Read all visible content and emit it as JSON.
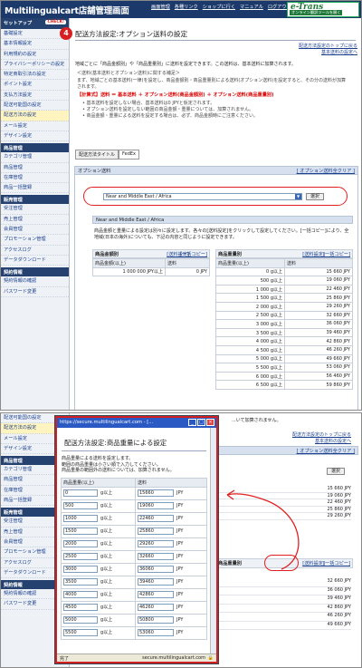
{
  "app_title": "Multilingualcart店舗管理画面",
  "topnav": [
    "画面管理",
    "各種リンク",
    "ショップに行く",
    "マニュアル",
    "ログアウト"
  ],
  "etrans": {
    "logo": "e-Trans",
    "tagline": "オンライン翻訳ツールを開く"
  },
  "setup_label": "セットアップ",
  "setup_btn": "CHECK!",
  "sidebar_setup": [
    "基礎設定",
    "基本情報設定",
    "利用規約の設定",
    "プライバシーポリシーの設定",
    "特定商取引法の設定",
    "ポイント設定",
    "支払方法設定",
    "配送可能国の設定",
    "配送方法の設定",
    "メール設定",
    "デザイン設定"
  ],
  "sidebar_sections": [
    {
      "title": "商品管理",
      "items": [
        "カテゴリ管理",
        "商品管理",
        "在庫管理",
        "商品一括登録"
      ]
    },
    {
      "title": "販売管理",
      "items": [
        "受注管理",
        "売上管理",
        "会員管理",
        "プロモーション管理",
        "アクセスログ",
        "データダウンロード"
      ]
    },
    {
      "title": "契約情報",
      "items": [
        "契約情報の確認",
        "パスワード変更"
      ]
    }
  ],
  "step_number": "4",
  "page_title": "配送方法設定:オプション送料の設定",
  "back_link_1": "配送方法設定のトップに戻る",
  "back_link_2": "基本送料の設定へ",
  "intro": "地域ごとに「商品金額別」や「商品重量別」に送料を設定できます。この送料は、基本送料に加算されます。",
  "notes_title": "＜送料(基本送料とオプション送料)に関する補足＞",
  "notes_text": "まず、地域ごとの基本送料(一律)を設定し、商品金額別・商品重量別による送料(オプション送料)を設定すると、その分の送料が加算されます。",
  "formula": "【計算式】送料 ＝ 基本送料 ＋ オプション送料(商品金額別) ＋ オプション送料(商品重量別)",
  "bullets": [
    "基本送料を設定しない場合、基本送料は0 JPYと仮定されます。",
    "オプション送料を設定しない範囲の商品金額・重量については、加算されません。",
    "商品金額・重量による送料を設定する場合は、必ず、商品金額時にご注意ください。"
  ],
  "tabs": [
    "配送方法タイトル",
    "FedEx"
  ],
  "option_box_title": "オプション送料",
  "option_box_link": "[ オプション送料全クリア ]",
  "region_selected": "Near and Middle East / Africa",
  "select_button": "選択",
  "region_heading": "Near and Middle East / Africa",
  "region_desc": "商品金額と重量による設定は別々に設定します。各々の[送料設定]をクリックして設定してください。[一括コピー]により、全地域(日本の海外)についても、下記の内容と同じように設定できます。",
  "price_table": {
    "title": "商品金額別",
    "links": [
      "[送料設定]",
      "[一括コピー]"
    ],
    "head": [
      "商品金額(以上)",
      "送料"
    ],
    "rows": [
      [
        "1 000 000 JPY以上",
        "0 JPY"
      ]
    ]
  },
  "weight_table": {
    "title": "商品重量別",
    "links": [
      "[送料設定]",
      "[一括コピー]"
    ],
    "head": [
      "商品重量(以上)",
      "送料"
    ],
    "rows": [
      [
        "0 g以上",
        "15 660 JPY"
      ],
      [
        "500 g以上",
        "19 060 JPY"
      ],
      [
        "1 000 g以上",
        "22 460 JPY"
      ],
      [
        "1 500 g以上",
        "25 860 JPY"
      ],
      [
        "2 000 g以上",
        "29 260 JPY"
      ],
      [
        "2 500 g以上",
        "32 660 JPY"
      ],
      [
        "3 000 g以上",
        "36 060 JPY"
      ],
      [
        "3 500 g以上",
        "39 460 JPY"
      ],
      [
        "4 000 g以上",
        "42 860 JPY"
      ],
      [
        "4 500 g以上",
        "46 260 JPY"
      ],
      [
        "5 000 g以上",
        "49 660 JPY"
      ],
      [
        "5 500 g以上",
        "53 060 JPY"
      ],
      [
        "6 000 g以上",
        "56 460 JPY"
      ],
      [
        "6 500 g以上",
        "59 860 JPY"
      ]
    ]
  },
  "popup": {
    "url": "https://secure.multilingualcart.com - [...",
    "title": "配送方法設定:商品重量による設定",
    "intro_lines": [
      "商品重量による送料を設定します。",
      "範囲の商品重量は小さい順で入力してください。",
      "商品重量の範囲外の送料については、加算されません。"
    ],
    "head": [
      "商品重量(以上)",
      "送料"
    ],
    "unit_g": "g以上",
    "unit_jpy": "JPY",
    "rows": [
      [
        "0",
        "15660"
      ],
      [
        "500",
        "19060"
      ],
      [
        "1000",
        "22460"
      ],
      [
        "1500",
        "25860"
      ],
      [
        "2000",
        "29260"
      ],
      [
        "2500",
        "32660"
      ],
      [
        "3000",
        "36060"
      ],
      [
        "3500",
        "39460"
      ],
      [
        "4000",
        "42860"
      ],
      [
        "4500",
        "46260"
      ],
      [
        "5000",
        "50800"
      ],
      [
        "5500",
        "53060"
      ]
    ],
    "status_left": "完了",
    "status_right": "secure.multilingualcart.com"
  },
  "bottom_main": {
    "snippet": "...いて加算されません。",
    "right_values": [
      "15 660 JPY",
      "19 060 JPY",
      "22 460 JPY",
      "25 860 JPY",
      "29 260 JPY",
      "32 660 JPY",
      "36 060 JPY",
      "39 460 JPY",
      "42 860 JPY",
      "46 260 JPY",
      "49 660 JPY"
    ]
  },
  "accent": "#d92020"
}
